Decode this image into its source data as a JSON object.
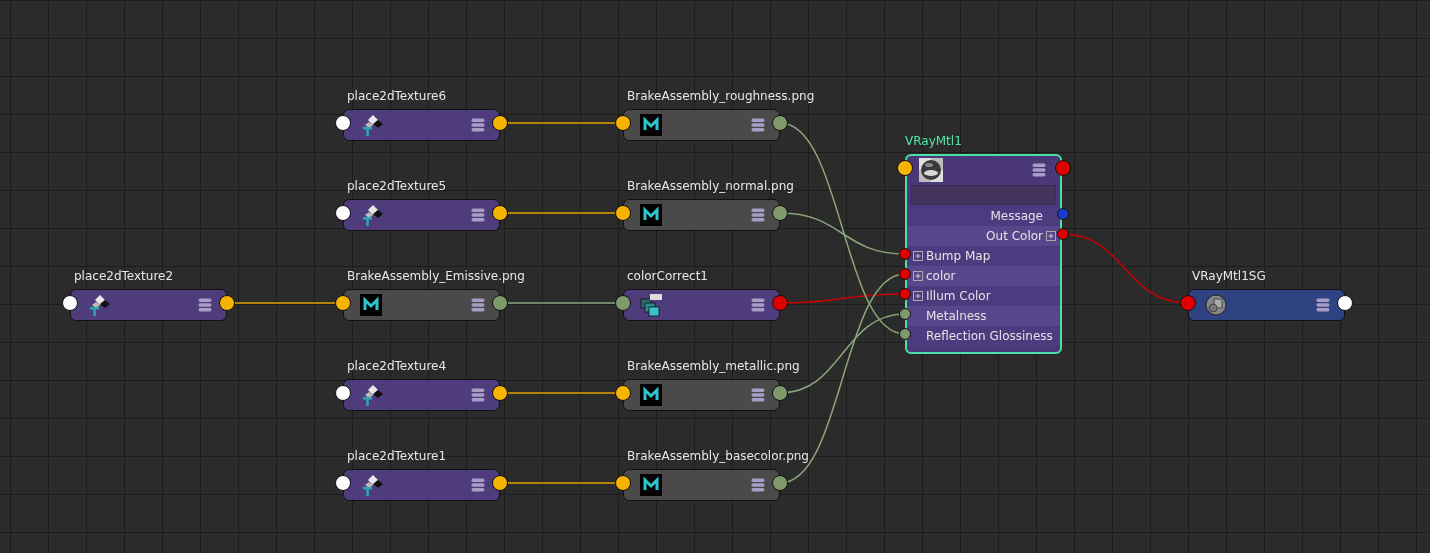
{
  "nodes": [
    {
      "kind": "place2d",
      "title": "place2dTexture6"
    },
    {
      "kind": "file",
      "title": "BrakeAssembly_roughness.png"
    },
    {
      "kind": "material",
      "title": "VRayMtl1",
      "attributes": [
        {
          "label": "Message",
          "kind": "output",
          "color": "#1a3ccc",
          "expandable": false
        },
        {
          "label": "Out Color",
          "kind": "output",
          "color": "#e00000",
          "expandable": true
        },
        {
          "label": "Bump Map",
          "kind": "input",
          "color": "#e00000",
          "expandable": true
        },
        {
          "label": "color",
          "kind": "input",
          "color": "#e00000",
          "expandable": true
        },
        {
          "label": "Illum Color",
          "kind": "input",
          "color": "#e00000",
          "expandable": true
        },
        {
          "label": "Metalness",
          "kind": "input",
          "color": "#7e9a6c",
          "expandable": false
        },
        {
          "label": "Reflection Glossiness",
          "kind": "input",
          "color": "#7e9a6c",
          "expandable": false
        }
      ]
    },
    {
      "kind": "place2d",
      "title": "place2dTexture5"
    },
    {
      "kind": "file",
      "title": "BrakeAssembly_normal.png"
    },
    {
      "kind": "place2d",
      "title": "place2dTexture2"
    },
    {
      "kind": "file",
      "title": "BrakeAssembly_Emissive.png"
    },
    {
      "kind": "colorCorrect",
      "title": "colorCorrect1"
    },
    {
      "kind": "shadingGroup",
      "title": "VRayMtl1SG"
    },
    {
      "kind": "place2d",
      "title": "place2dTexture4"
    },
    {
      "kind": "file",
      "title": "BrakeAssembly_metallic.png"
    },
    {
      "kind": "place2d",
      "title": "place2dTexture1"
    },
    {
      "kind": "file",
      "title": "BrakeAssembly_basecolor.png"
    }
  ]
}
